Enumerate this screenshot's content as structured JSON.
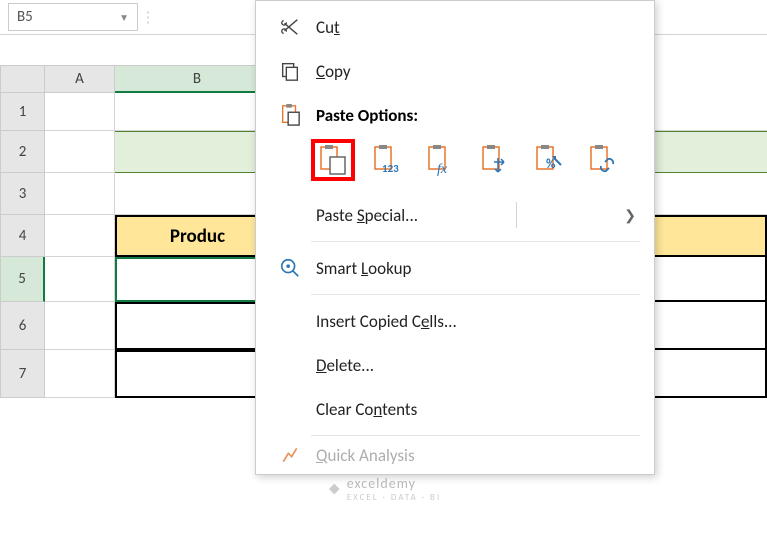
{
  "nameBox": {
    "value": "B5"
  },
  "columns": [
    "A",
    "B"
  ],
  "rows": [
    "1",
    "2",
    "3",
    "4",
    "5",
    "6",
    "7"
  ],
  "sheet": {
    "headerB4": "Produc"
  },
  "menu": {
    "cut": "Cut",
    "copy": "Copy",
    "pasteOptionsHeader": "Paste Options:",
    "pasteSpecial": "Paste Special...",
    "smartLookup": "Smart Lookup",
    "insertCopied": "Insert Copied Cells...",
    "delete": "Delete...",
    "clearContents": "Clear Contents",
    "quickAnalysis": "Quick Analysis",
    "pasteOpts": {
      "paste": "paste",
      "values": "paste-values",
      "formulas": "paste-formulas",
      "transpose": "paste-transpose",
      "formatting": "paste-formatting",
      "link": "paste-link"
    }
  },
  "watermark": {
    "brand": "exceldemy",
    "tagline": "EXCEL · DATA · BI"
  }
}
